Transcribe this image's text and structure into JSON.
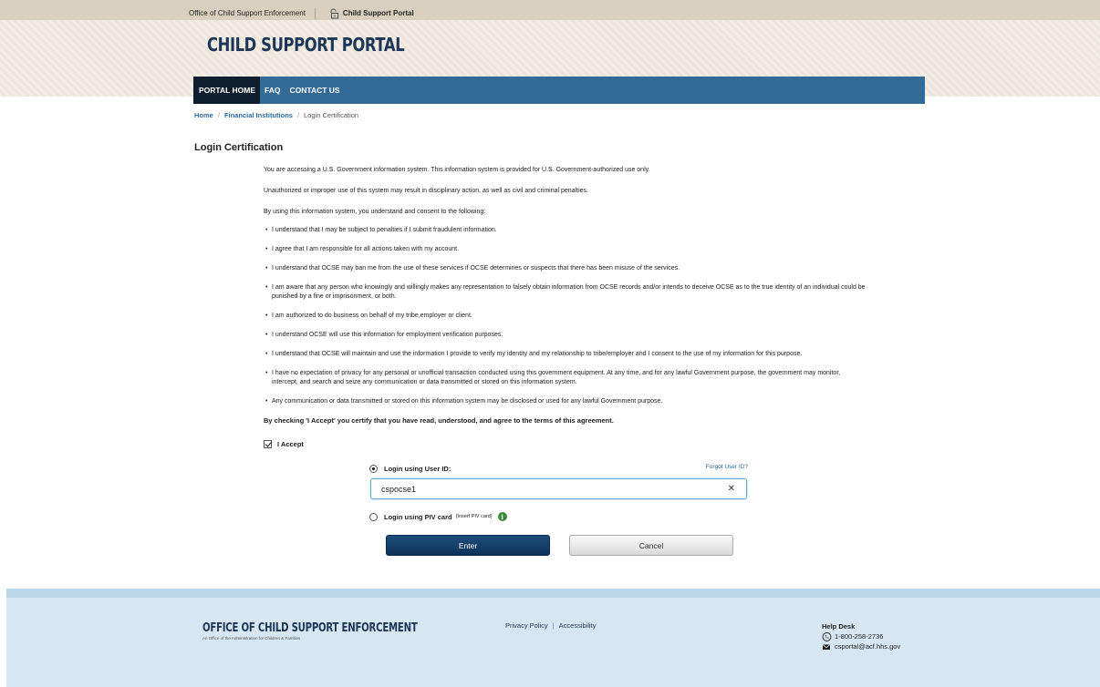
{
  "topbar": {
    "agency_link": "Office of Child Support Enforcement",
    "portal_link": "Child Support Portal"
  },
  "header": {
    "title": "CHILD SUPPORT PORTAL"
  },
  "nav": {
    "items": [
      {
        "label": "PORTAL HOME",
        "active": true
      },
      {
        "label": "FAQ",
        "active": false
      },
      {
        "label": "CONTACT US",
        "active": false
      }
    ]
  },
  "breadcrumb": {
    "items": [
      "Home",
      "Financial Institutions",
      "Login Certification"
    ],
    "separator": "/"
  },
  "page": {
    "title": "Login Certification"
  },
  "certification": {
    "intro": [
      "You are accessing a U.S. Government information system. This information system is provided for U.S. Government-authorized use only.",
      "Unauthorized or improper use of this system may result in disciplinary action, as well as civil and criminal penalties.",
      "By using this information system, you understand and consent to the following:"
    ],
    "bullets": [
      "I understand that I may be subject to penalties if I submit fraudulent information.",
      "I agree that I am responsible for all actions taken with my account.",
      "I understand that OCSE may ban me from the use of these services if OCSE determines or suspects that there has been misuse of the services.",
      "I am aware that any person who knowingly and willingly makes any representation to falsely obtain information from OCSE records and/or intends to deceive OCSE as to the true identity of an individual could be punished by a fine or imprisonment, or both.",
      "I am authorized to do business on behalf of my tribe,employer or client.",
      "I understand OCSE will use this information for employment verification purposes.",
      "I understand that OCSE will maintain and use the information I provide to verify my identity and my relationship to tribe/employer and I consent to the use of my information for this purpose.",
      "I have no expectation of privacy for any personal or unofficial transaction conducted using this government equipment. At any time, and for any lawful Government purpose, the government may monitor, intercept, and search and seize any communication or data transmitted or stored on this information system.",
      "Any communication or data transmitted or stored on this information system may be disclosed or used for any lawful Government purpose."
    ],
    "agreement": "By checking 'I Accept' you certify that you have read, understood, and agree to the terms of this agreement.",
    "accept_label": "I Accept",
    "accept_checked": true
  },
  "login": {
    "userid_label": "Login using User ID:",
    "forgot_label": "Forgot User ID?",
    "userid_value": "cspocse1",
    "clear_glyph": "✕",
    "piv_label": "Login using PIV card",
    "piv_hint": "(Insert PIV card)",
    "info_glyph": "i",
    "selected_method": "userid",
    "enter_label": "Enter",
    "cancel_label": "Cancel"
  },
  "footer": {
    "logo_title": "OFFICE OF CHILD SUPPORT ENFORCEMENT",
    "logo_tagline": "An Office of the Administration for Children & Families",
    "links": [
      "Privacy Policy",
      "Accessibility"
    ],
    "link_separator": "|",
    "helpdesk_title": "Help Desk",
    "phone": "1-800-258-2736",
    "email": "csportal@acf.hhs.gov"
  },
  "colors": {
    "nav_bg": "#336a96",
    "nav_active_bg": "#0f1e2d",
    "title_color": "#1d3556",
    "link_color": "#2a6aa4",
    "enter_bg": "#0e3259",
    "footer_bg": "#d6e6f2"
  }
}
